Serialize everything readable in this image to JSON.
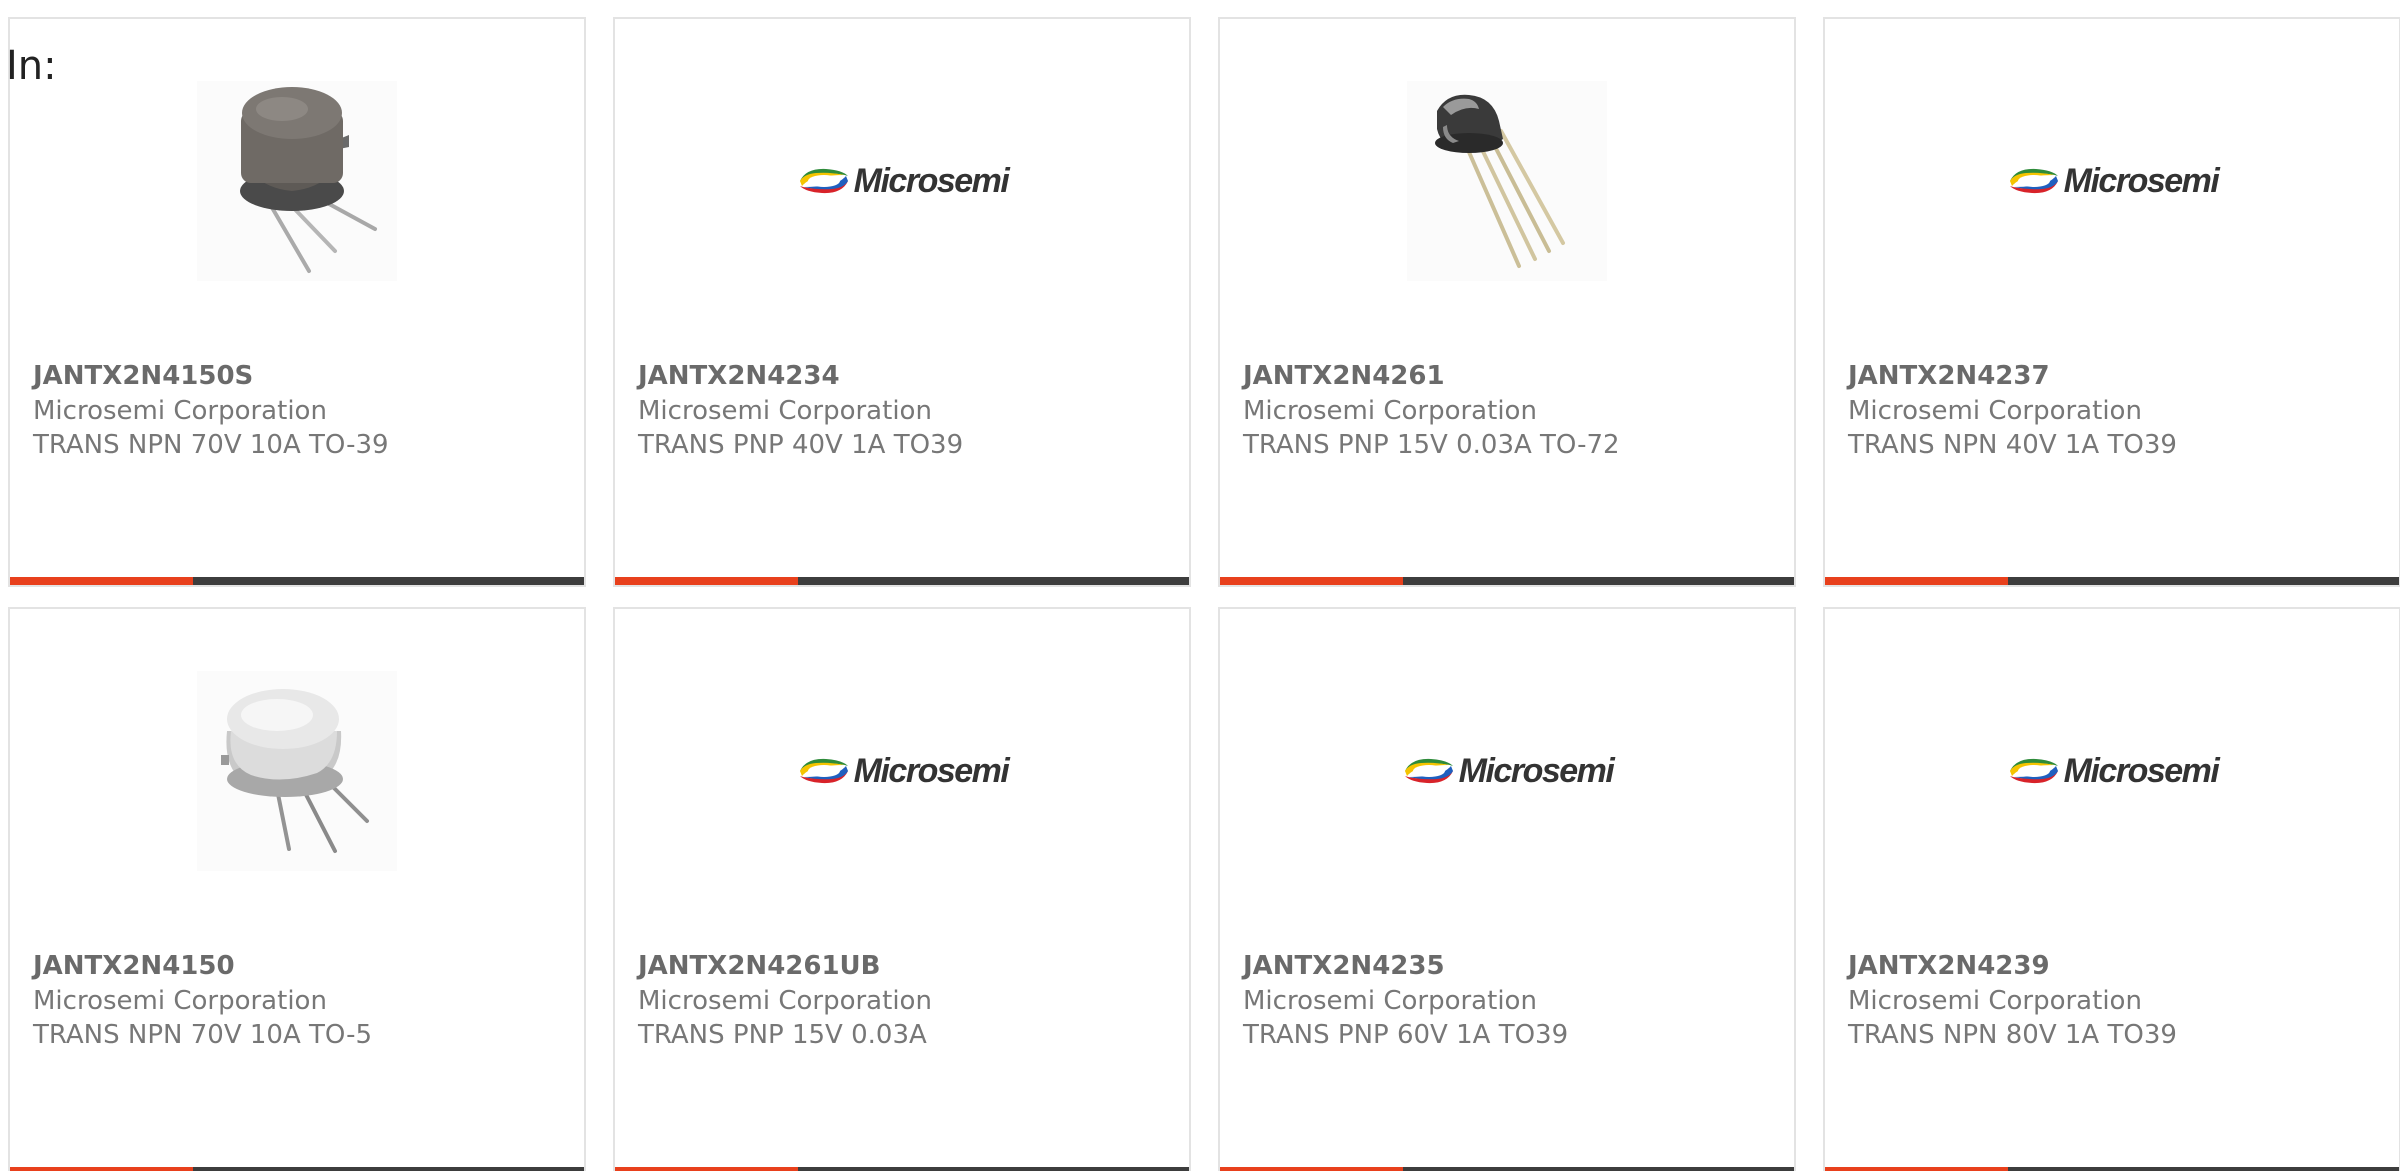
{
  "header": {
    "in_label": "In:"
  },
  "colors": {
    "accent": "#e8401c",
    "bar": "#3d3d3d",
    "card_border": "#e3e3e3",
    "text": "#777777"
  },
  "products": [
    {
      "part_number": "JANTX2N4150S",
      "manufacturer": "Microsemi Corporation",
      "description": "TRANS NPN 70V 10A TO-39",
      "image": "to39-can-dark-photo",
      "logo_text": ""
    },
    {
      "part_number": "JANTX2N4234",
      "manufacturer": "Microsemi Corporation",
      "description": "TRANS PNP 40V 1A TO39",
      "image": "microsemi-logo",
      "logo_text": "Microsemi"
    },
    {
      "part_number": "JANTX2N4261",
      "manufacturer": "Microsemi Corporation",
      "description": "TRANS PNP 15V 0.03A TO-72",
      "image": "to72-can-photo",
      "logo_text": ""
    },
    {
      "part_number": "JANTX2N4237",
      "manufacturer": "Microsemi Corporation",
      "description": "TRANS NPN 40V 1A TO39",
      "image": "microsemi-logo",
      "logo_text": "Microsemi"
    },
    {
      "part_number": "JANTX2N4150",
      "manufacturer": "Microsemi Corporation",
      "description": "TRANS NPN 70V 10A TO-5",
      "image": "to5-can-silver-photo",
      "logo_text": ""
    },
    {
      "part_number": "JANTX2N4261UB",
      "manufacturer": "Microsemi Corporation",
      "description": "TRANS PNP 15V 0.03A",
      "image": "microsemi-logo",
      "logo_text": "Microsemi"
    },
    {
      "part_number": "JANTX2N4235",
      "manufacturer": "Microsemi Corporation",
      "description": "TRANS PNP 60V 1A TO39",
      "image": "microsemi-logo",
      "logo_text": "Microsemi"
    },
    {
      "part_number": "JANTX2N4239",
      "manufacturer": "Microsemi Corporation",
      "description": "TRANS NPN 80V 1A TO39",
      "image": "microsemi-logo",
      "logo_text": "Microsemi"
    }
  ]
}
